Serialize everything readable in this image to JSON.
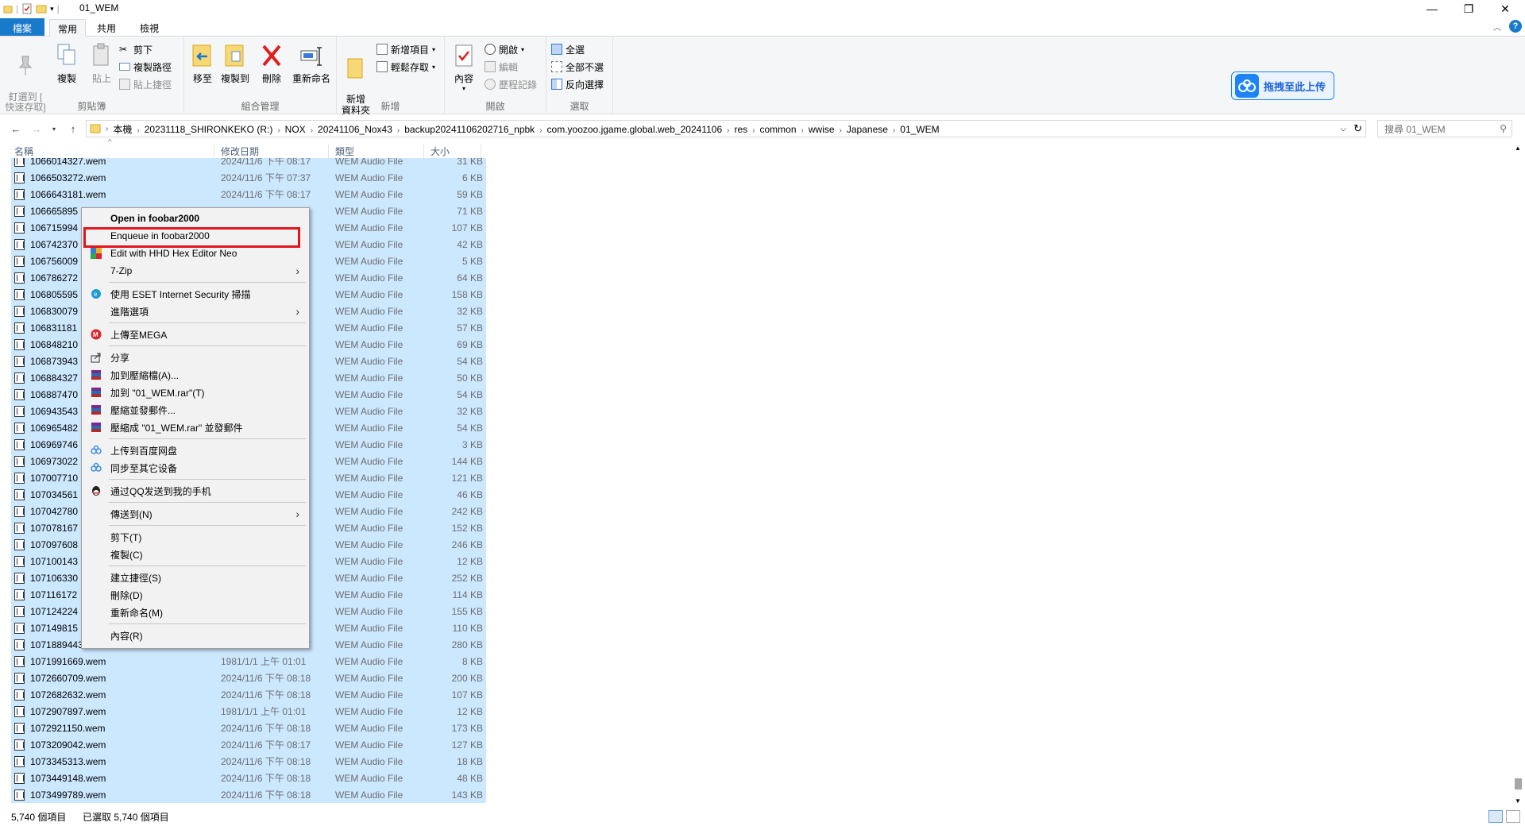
{
  "window": {
    "title": "01_WEM",
    "controls": {
      "minimize": "—",
      "maximize": "❐",
      "close": "✕"
    }
  },
  "ribbon_tabs": [
    "檔案",
    "常用",
    "共用",
    "檢視"
  ],
  "ribbon": {
    "clipboard": {
      "label": "剪貼簿",
      "pin": "釘選到 [\n快速存取]",
      "copy": "複製",
      "paste": "貼上",
      "cut": "剪下",
      "copy_path": "複製路徑",
      "paste_shortcut": "貼上捷徑"
    },
    "organize": {
      "label": "組合管理",
      "move_to": "移至",
      "copy_to": "複製到",
      "delete": "刪除",
      "rename": "重新命名"
    },
    "new": {
      "label": "新增",
      "new_folder": "新增\n資料夾",
      "new_item": "新增項目",
      "easy_access": "輕鬆存取"
    },
    "open": {
      "label": "開啟",
      "properties": "內容",
      "open": "開啟",
      "edit": "編輯",
      "history": "歷程記錄"
    },
    "select": {
      "label": "選取",
      "select_all": "全選",
      "select_none": "全部不選",
      "invert": "反向選擇"
    }
  },
  "upload_badge": "拖拽至此上传",
  "address": {
    "crumbs": [
      "本機",
      "20231118_SHIRONKEKO (R:)",
      "NOX",
      "20241106_Nox43",
      "backup20241106202716_npbk",
      "com.yoozoo.jgame.global.web_20241106",
      "res",
      "common",
      "wwise",
      "Japanese",
      "01_WEM"
    ],
    "search_placeholder": "搜尋 01_WEM"
  },
  "columns": {
    "name": "名稱",
    "date": "修改日期",
    "type": "類型",
    "size": "大小"
  },
  "files": [
    {
      "name": "1066014327.wem",
      "date": "2024/11/6 下午 08:17",
      "type": "WEM Audio File",
      "size": "31 KB"
    },
    {
      "name": "1066503272.wem",
      "date": "2024/11/6 下午 07:37",
      "type": "WEM Audio File",
      "size": "6 KB"
    },
    {
      "name": "1066643181.wem",
      "date": "2024/11/6 下午 08:17",
      "type": "WEM Audio File",
      "size": "59 KB"
    },
    {
      "name": "106665895",
      "date": "7",
      "type": "WEM Audio File",
      "size": "71 KB"
    },
    {
      "name": "106715994",
      "date": "8",
      "type": "WEM Audio File",
      "size": "107 KB"
    },
    {
      "name": "106742370",
      "date": "8",
      "type": "WEM Audio File",
      "size": "42 KB"
    },
    {
      "name": "106756009",
      "date": "8",
      "type": "WEM Audio File",
      "size": "5 KB"
    },
    {
      "name": "106786272",
      "date": "7",
      "type": "WEM Audio File",
      "size": "64 KB"
    },
    {
      "name": "106805595",
      "date": "7",
      "type": "WEM Audio File",
      "size": "158 KB"
    },
    {
      "name": "106830079",
      "date": "8",
      "type": "WEM Audio File",
      "size": "32 KB"
    },
    {
      "name": "106831181",
      "date": "8",
      "type": "WEM Audio File",
      "size": "57 KB"
    },
    {
      "name": "106848210",
      "date": "8",
      "type": "WEM Audio File",
      "size": "69 KB"
    },
    {
      "name": "106873943",
      "date": "8",
      "type": "WEM Audio File",
      "size": "54 KB"
    },
    {
      "name": "106884327",
      "date": "8",
      "type": "WEM Audio File",
      "size": "50 KB"
    },
    {
      "name": "106887470",
      "date": "8",
      "type": "WEM Audio File",
      "size": "54 KB"
    },
    {
      "name": "106943543",
      "date": "8",
      "type": "WEM Audio File",
      "size": "32 KB"
    },
    {
      "name": "106965482",
      "date": "8",
      "type": "WEM Audio File",
      "size": "54 KB"
    },
    {
      "name": "106969746",
      "date": "8",
      "type": "WEM Audio File",
      "size": "3 KB"
    },
    {
      "name": "106973022",
      "date": "7",
      "type": "WEM Audio File",
      "size": "144 KB"
    },
    {
      "name": "107007710",
      "date": "8",
      "type": "WEM Audio File",
      "size": "121 KB"
    },
    {
      "name": "107034561",
      "date": "8",
      "type": "WEM Audio File",
      "size": "46 KB"
    },
    {
      "name": "107042780",
      "date": "8",
      "type": "WEM Audio File",
      "size": "242 KB"
    },
    {
      "name": "107078167",
      "date": "8",
      "type": "WEM Audio File",
      "size": "152 KB"
    },
    {
      "name": "107097608",
      "date": "8",
      "type": "WEM Audio File",
      "size": "246 KB"
    },
    {
      "name": "107100143",
      "date": "8",
      "type": "WEM Audio File",
      "size": "12 KB"
    },
    {
      "name": "107106330",
      "date": "7",
      "type": "WEM Audio File",
      "size": "252 KB"
    },
    {
      "name": "107116172",
      "date": "8",
      "type": "WEM Audio File",
      "size": "114 KB"
    },
    {
      "name": "107124224",
      "date": "8",
      "type": "WEM Audio File",
      "size": "155 KB"
    },
    {
      "name": "107149815",
      "date": "8",
      "type": "WEM Audio File",
      "size": "110 KB"
    },
    {
      "name": "1071889443.wem",
      "date": "2024/11/6 下午 08:17",
      "type": "WEM Audio File",
      "size": "280 KB"
    },
    {
      "name": "1071991669.wem",
      "date": "1981/1/1 上午 01:01",
      "type": "WEM Audio File",
      "size": "8 KB"
    },
    {
      "name": "1072660709.wem",
      "date": "2024/11/6 下午 08:18",
      "type": "WEM Audio File",
      "size": "200 KB"
    },
    {
      "name": "1072682632.wem",
      "date": "2024/11/6 下午 08:18",
      "type": "WEM Audio File",
      "size": "107 KB"
    },
    {
      "name": "1072907897.wem",
      "date": "1981/1/1 上午 01:01",
      "type": "WEM Audio File",
      "size": "12 KB"
    },
    {
      "name": "1072921150.wem",
      "date": "2024/11/6 下午 08:18",
      "type": "WEM Audio File",
      "size": "173 KB"
    },
    {
      "name": "1073209042.wem",
      "date": "2024/11/6 下午 08:17",
      "type": "WEM Audio File",
      "size": "127 KB"
    },
    {
      "name": "1073345313.wem",
      "date": "2024/11/6 下午 08:18",
      "type": "WEM Audio File",
      "size": "18 KB"
    },
    {
      "name": "1073449148.wem",
      "date": "2024/11/6 下午 08:18",
      "type": "WEM Audio File",
      "size": "48 KB"
    },
    {
      "name": "1073499789.wem",
      "date": "2024/11/6 下午 08:18",
      "type": "WEM Audio File",
      "size": "143 KB"
    }
  ],
  "context_menu": [
    {
      "label": "Open in foobar2000",
      "bold": true,
      "icon": ""
    },
    {
      "label": "Enqueue in foobar2000",
      "icon": "",
      "highlighted": true
    },
    {
      "label": "Edit with HHD Hex Editor Neo",
      "icon": "hex-editor-icon"
    },
    {
      "label": "7-Zip",
      "icon": "",
      "submenu": true
    },
    {
      "separator": true
    },
    {
      "label": "使用 ESET Internet Security 掃描",
      "icon": "eset-icon"
    },
    {
      "label": "進階選項",
      "icon": "",
      "submenu": true
    },
    {
      "separator": true
    },
    {
      "label": "上傳至MEGA",
      "icon": "mega-icon"
    },
    {
      "separator": true
    },
    {
      "label": "分享",
      "icon": "share-icon"
    },
    {
      "label": "加到壓縮檔(A)...",
      "icon": "winrar-icon"
    },
    {
      "label": "加到 \"01_WEM.rar\"(T)",
      "icon": "winrar-icon"
    },
    {
      "label": "壓縮並發郵件...",
      "icon": "winrar-icon"
    },
    {
      "label": "壓縮成 \"01_WEM.rar\" 並發郵件",
      "icon": "winrar-icon"
    },
    {
      "separator": true
    },
    {
      "label": "上传到百度网盘",
      "icon": "baidu-icon"
    },
    {
      "label": "同步至其它设备",
      "icon": "baidu-icon"
    },
    {
      "separator": true
    },
    {
      "label": "通过QQ发送到我的手机",
      "icon": "qq-icon"
    },
    {
      "separator": true
    },
    {
      "label": "傳送到(N)",
      "icon": "",
      "submenu": true
    },
    {
      "separator": true
    },
    {
      "label": "剪下(T)",
      "icon": ""
    },
    {
      "label": "複製(C)",
      "icon": ""
    },
    {
      "separator": true
    },
    {
      "label": "建立捷徑(S)",
      "icon": ""
    },
    {
      "label": "刪除(D)",
      "icon": ""
    },
    {
      "label": "重新命名(M)",
      "icon": ""
    },
    {
      "separator": true
    },
    {
      "label": "內容(R)",
      "icon": ""
    }
  ],
  "status": {
    "count": "5,740 個項目",
    "selected": "已選取 5,740 個項目"
  },
  "colors": {
    "selection": "#cce8ff",
    "file_tab": "#1979ca",
    "highlight_border": "#e0141e"
  }
}
